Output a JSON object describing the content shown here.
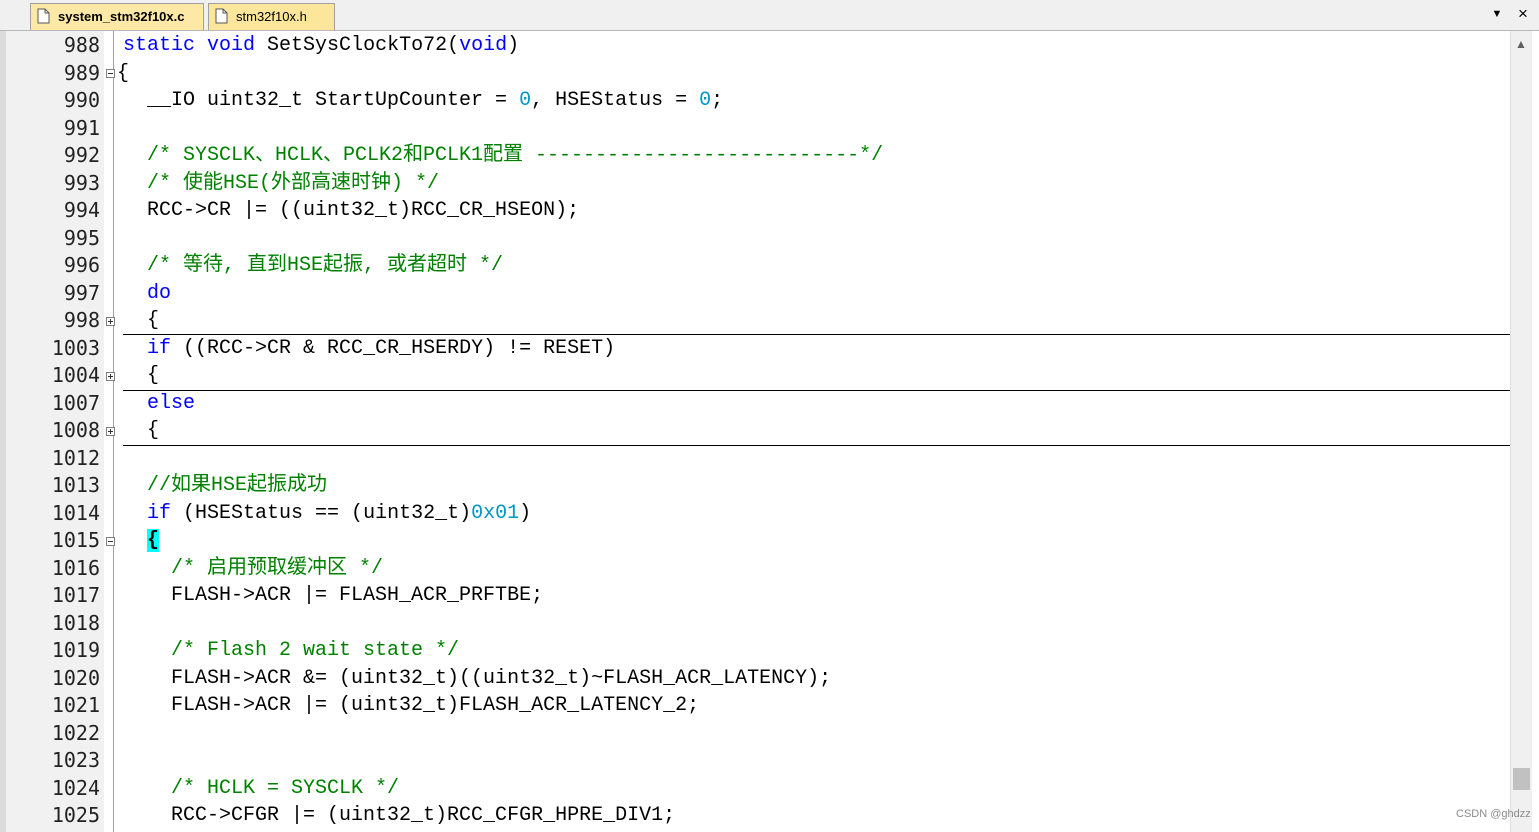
{
  "tabs": [
    {
      "label": "system_stm32f10x.c",
      "active": true
    },
    {
      "label": "stm32f10x.h",
      "active": false
    }
  ],
  "tabbar": {
    "dropdown_icon": "▼",
    "close_icon": "×"
  },
  "lines": [
    {
      "num": "988"
    },
    {
      "num": "989"
    },
    {
      "num": "990"
    },
    {
      "num": "991"
    },
    {
      "num": "992"
    },
    {
      "num": "993"
    },
    {
      "num": "994"
    },
    {
      "num": "995"
    },
    {
      "num": "996"
    },
    {
      "num": "997"
    },
    {
      "num": "998"
    },
    {
      "num": "1003"
    },
    {
      "num": "1004"
    },
    {
      "num": "1007"
    },
    {
      "num": "1008"
    },
    {
      "num": "1012"
    },
    {
      "num": "1013"
    },
    {
      "num": "1014"
    },
    {
      "num": "1015"
    },
    {
      "num": "1016"
    },
    {
      "num": "1017"
    },
    {
      "num": "1018"
    },
    {
      "num": "1019"
    },
    {
      "num": "1020"
    },
    {
      "num": "1021"
    },
    {
      "num": "1022"
    },
    {
      "num": "1023"
    },
    {
      "num": "1024"
    },
    {
      "num": "1025"
    }
  ],
  "code": {
    "l988_kw1": "static",
    "l988_kw2": "void",
    "l988_mid": " SetSysClockTo72(",
    "l988_kw3": "void",
    "l988_end": ")",
    "l989": "{",
    "l990_a": "  __IO uint32_t StartUpCounter = ",
    "l990_n1": "0",
    "l990_b": ", HSEStatus = ",
    "l990_n2": "0",
    "l990_c": ";",
    "l992": "  /* SYSCLK、HCLK、PCLK2和PCLK1配置 ---------------------------*/",
    "l993": "  /* 使能HSE(外部高速时钟) */",
    "l994": "  RCC->CR |= ((uint32_t)RCC_CR_HSEON);",
    "l996": "  /* 等待, 直到HSE起振, 或者超时 */",
    "l997_indent": "  ",
    "l997_kw": "do",
    "l998": "  {",
    "l1003_indent": "  ",
    "l1003_kw": "if",
    "l1003_rest": " ((RCC->CR & RCC_CR_HSERDY) != RESET)",
    "l1004": "  {",
    "l1007_indent": "  ",
    "l1007_kw": "else",
    "l1008": "  {",
    "l1013": "  //如果HSE起振成功",
    "l1014_indent": "  ",
    "l1014_kw": "if",
    "l1014_rest": " (HSEStatus == (uint32_t)",
    "l1014_num": "0x01",
    "l1014_end": ")",
    "l1015_indent": "  ",
    "l1015_brace": "{",
    "l1016": "    /* 启用预取缓冲区 */",
    "l1017": "    FLASH->ACR |= FLASH_ACR_PRFTBE;",
    "l1019": "    /* Flash 2 wait state */",
    "l1020": "    FLASH->ACR &= (uint32_t)((uint32_t)~FLASH_ACR_LATENCY);",
    "l1021": "    FLASH->ACR |= (uint32_t)FLASH_ACR_LATENCY_2;",
    "l1024": "    /* HCLK = SYSCLK */",
    "l1025": "    RCC->CFGR |= (uint32_t)RCC_CFGR_HPRE_DIV1;"
  },
  "scrollbar": {
    "up_arrow": "▲"
  },
  "watermark": "CSDN @ghdzz"
}
